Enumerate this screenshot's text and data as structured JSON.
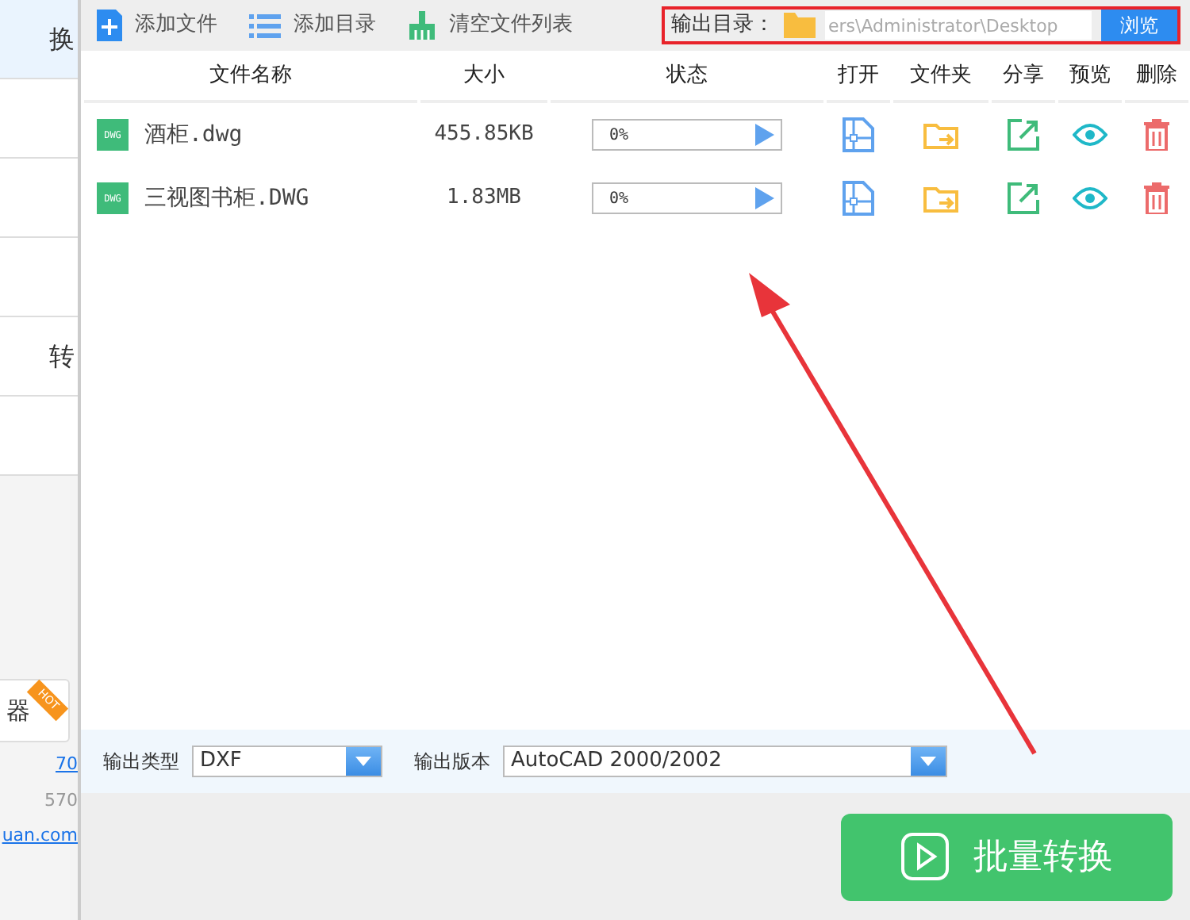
{
  "sidebar": {
    "items": [
      {
        "label": "换",
        "selected": true
      },
      {
        "selected": false
      },
      {
        "selected": false
      },
      {
        "selected": false
      },
      {
        "label": "转",
        "selected": false
      },
      {
        "selected": false
      }
    ],
    "promo": {
      "label": "器",
      "badge": "HOT"
    },
    "links": [
      {
        "text": "70",
        "kind": "link"
      },
      {
        "text": "570",
        "kind": "text"
      },
      {
        "text": "uan.com",
        "kind": "link"
      }
    ]
  },
  "toolbar": [
    {
      "label": "添加文件"
    },
    {
      "label": "添加目录"
    },
    {
      "label": "清空文件列表"
    }
  ],
  "output_dir": {
    "label": "输出目录：",
    "value": "ers\\Administrator\\Desktop",
    "button": "浏览"
  },
  "table": {
    "columns": [
      "文件名称",
      "大小",
      "状态",
      "打开",
      "文件夹",
      "分享",
      "预览",
      "删除"
    ],
    "rows": [
      {
        "file_icon": "DWG",
        "name": "酒柜.dwg",
        "size": "455.85KB",
        "status": "0%",
        "level": 0
      },
      {
        "file_icon": "DWG",
        "name": "三视图书柜.DWG",
        "size": "1.83MB",
        "status": "0%",
        "level": 0
      }
    ]
  },
  "output_type": {
    "label": "输出类型",
    "value": "DXF"
  },
  "output_version": {
    "label": "输出版本",
    "value": "AutoCAD 2000/2002"
  },
  "convert_button": "批量转换"
}
